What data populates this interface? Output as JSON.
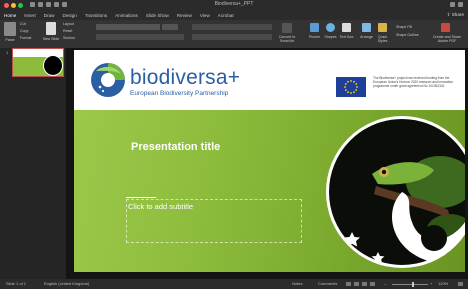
{
  "window": {
    "title": "Biodiversa+_PPT"
  },
  "tabs": [
    "Home",
    "Insert",
    "Draw",
    "Design",
    "Transitions",
    "Animations",
    "Slide Show",
    "Review",
    "View",
    "Acrobat"
  ],
  "share_label": "Share",
  "ribbon": {
    "paste_label": "Paste",
    "cut_label": "Cut",
    "copy_label": "Copy",
    "format_label": "Format",
    "new_slide_label": "New Slide",
    "layout_label": "Layout",
    "reset_label": "Reset",
    "section_label": "Section",
    "convert_label": "Convert to SmartArt",
    "picture_label": "Picture",
    "shapes_label": "Shapes",
    "textbox_label": "Text Box",
    "arrange_label": "Arrange",
    "quick_styles_label": "Quick Styles",
    "shape_fill_label": "Shape Fill",
    "shape_outline_label": "Shape Outline",
    "share_pdf_label": "Create and Share Adobe PDF"
  },
  "thumbnails": [
    {
      "number": "1"
    }
  ],
  "slide": {
    "brand_name": "biodiversa+",
    "brand_subtitle": "European Biodiversity Partnership",
    "eu_text": "The Biodiversa+ project has received funding from the European Union's Horizon 2020 research and innovation programme under grant agreement No 101052342",
    "title": "Presentation title",
    "subtitle_placeholder": "Click to add subtitle"
  },
  "status": {
    "slide_count": "Slide 1 of 1",
    "language": "English (United Kingdom)",
    "notes_label": "Notes",
    "comments_label": "Comments",
    "zoom": "120%"
  },
  "colors": {
    "accent": "#c0504d",
    "brand_blue": "#2b5fa3",
    "slide_green": "#8dbc3c",
    "eu_blue": "#1f3f99"
  }
}
